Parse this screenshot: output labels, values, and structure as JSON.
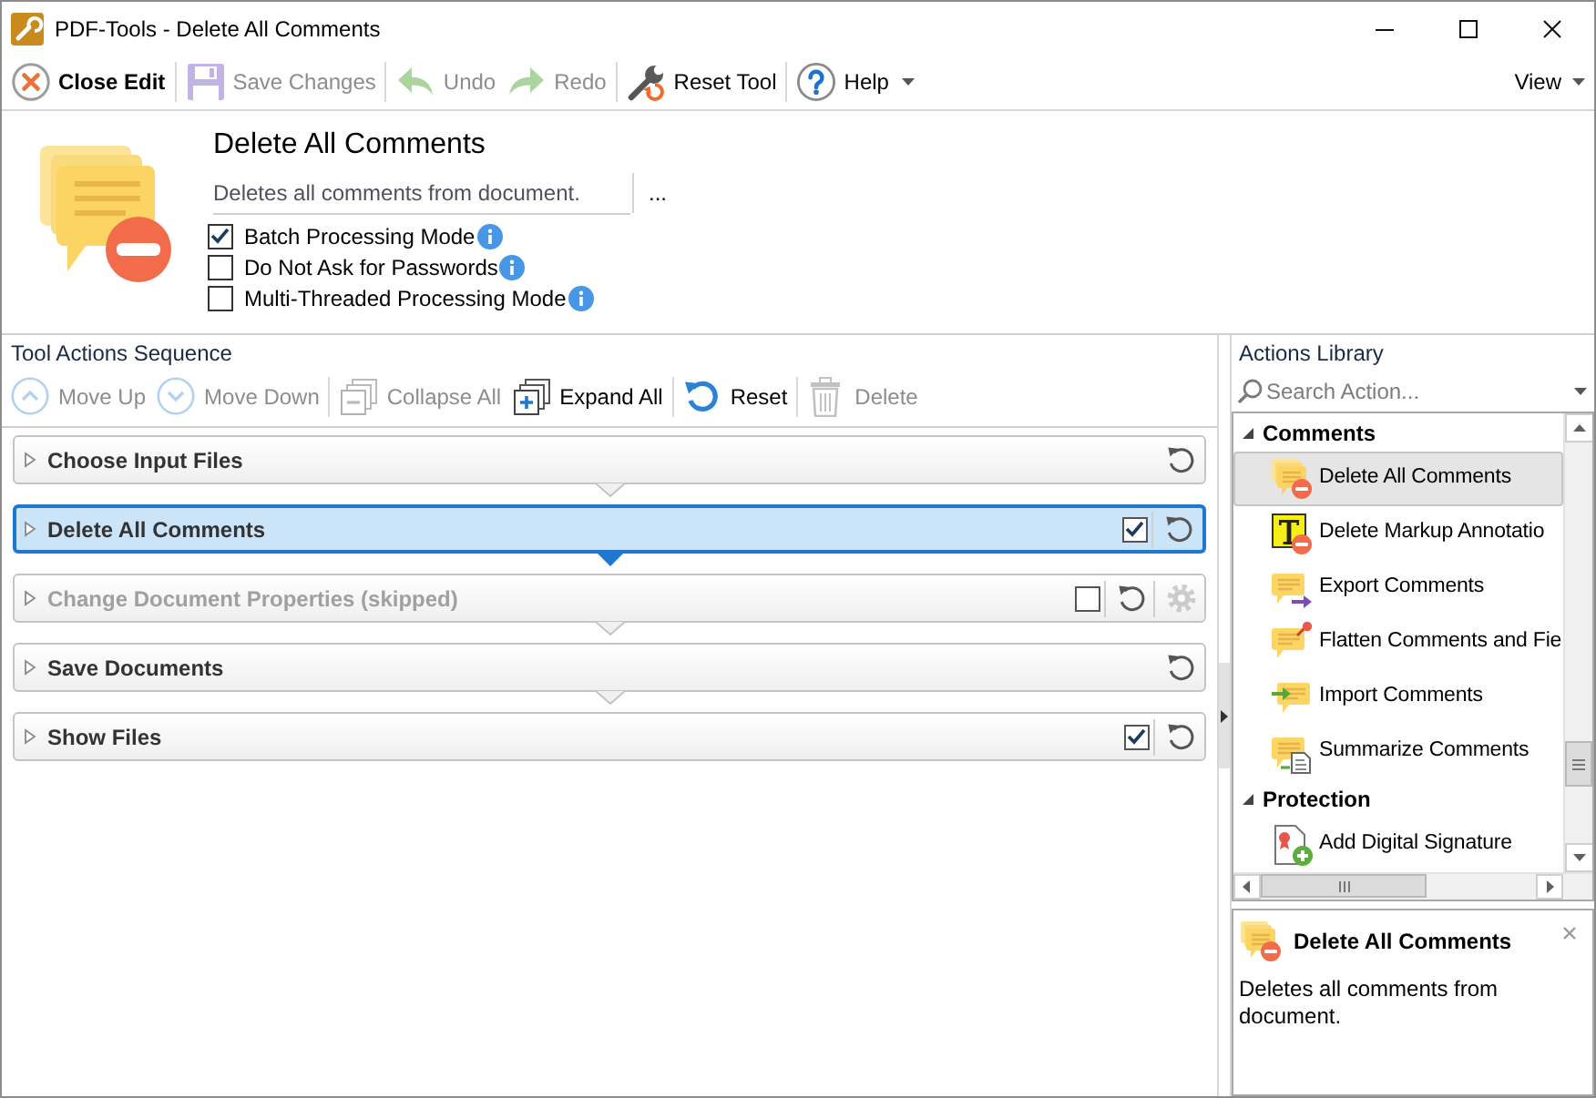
{
  "window": {
    "title": "PDF-Tools - Delete All Comments"
  },
  "toolbar": {
    "groups": [
      {
        "items": [
          {
            "label": "Close Edit",
            "kind": "button",
            "primary": true,
            "disabled": false
          }
        ]
      },
      {
        "items": [
          {
            "label": "Save Changes",
            "kind": "button",
            "primary": false,
            "disabled": true
          }
        ]
      },
      {
        "items": [
          {
            "label": "Undo",
            "kind": "button",
            "primary": false,
            "disabled": true
          },
          {
            "label": "Redo",
            "kind": "button",
            "primary": false,
            "disabled": true
          }
        ]
      },
      {
        "items": [
          {
            "label": "Reset Tool",
            "kind": "button",
            "primary": false,
            "disabled": false
          }
        ]
      },
      {
        "items": [
          {
            "label": "Help",
            "kind": "menu",
            "primary": false,
            "disabled": false
          }
        ]
      }
    ],
    "view_menu": {
      "label": "View"
    }
  },
  "tool_header": {
    "title": "Delete All Comments",
    "description": "Deletes all comments from document.",
    "more_button": "...",
    "options": [
      {
        "label": "Batch Processing Mode",
        "checked": true
      },
      {
        "label": "Do Not Ask for Passwords",
        "checked": false
      },
      {
        "label": "Multi-Threaded Processing Mode",
        "checked": false
      }
    ]
  },
  "sequence_panel": {
    "title": "Tool Actions Sequence",
    "toolbar": {
      "groups": [
        {
          "items": [
            {
              "label": "Move Up",
              "disabled": true
            },
            {
              "label": "Move Down",
              "disabled": true
            }
          ]
        },
        {
          "items": [
            {
              "label": "Collapse All",
              "disabled": true
            },
            {
              "label": "Expand All",
              "disabled": false
            }
          ]
        },
        {
          "items": [
            {
              "label": "Reset",
              "disabled": false
            }
          ]
        },
        {
          "items": [
            {
              "label": "Delete",
              "disabled": true
            }
          ]
        }
      ]
    },
    "actions": [
      {
        "label": "Choose Input Files",
        "selected": false,
        "skipped": false
      },
      {
        "label": "Delete All Comments",
        "selected": true,
        "skipped": false,
        "checkbox": {
          "checked": true
        }
      },
      {
        "label": "Change Document Properties (skipped)",
        "selected": false,
        "skipped": true,
        "checkbox": {
          "checked": false
        },
        "settings_button": {
          "disabled": true
        }
      },
      {
        "label": "Save Documents",
        "selected": false,
        "skipped": false
      },
      {
        "label": "Show Files",
        "selected": false,
        "skipped": false,
        "checkbox": {
          "checked": true
        }
      }
    ]
  },
  "library_panel": {
    "title": "Actions Library",
    "search": {
      "placeholder": "Search Action..."
    },
    "groups": [
      {
        "label": "Comments",
        "expanded": true,
        "children": [
          {
            "label": "Delete All Comments",
            "selected": true
          },
          {
            "label": "Delete Markup Annotatio",
            "selected": false
          },
          {
            "label": "Export Comments",
            "selected": false
          },
          {
            "label": "Flatten Comments and Fie",
            "selected": false
          },
          {
            "label": "Import Comments",
            "selected": false
          },
          {
            "label": "Summarize Comments",
            "selected": false
          }
        ]
      },
      {
        "label": "Protection",
        "expanded": true,
        "children": [
          {
            "label": "Add Digital Signature",
            "selected": false
          }
        ]
      }
    ]
  },
  "details_panel": {
    "title": "Delete All Comments",
    "description": "Deletes all comments from document."
  }
}
